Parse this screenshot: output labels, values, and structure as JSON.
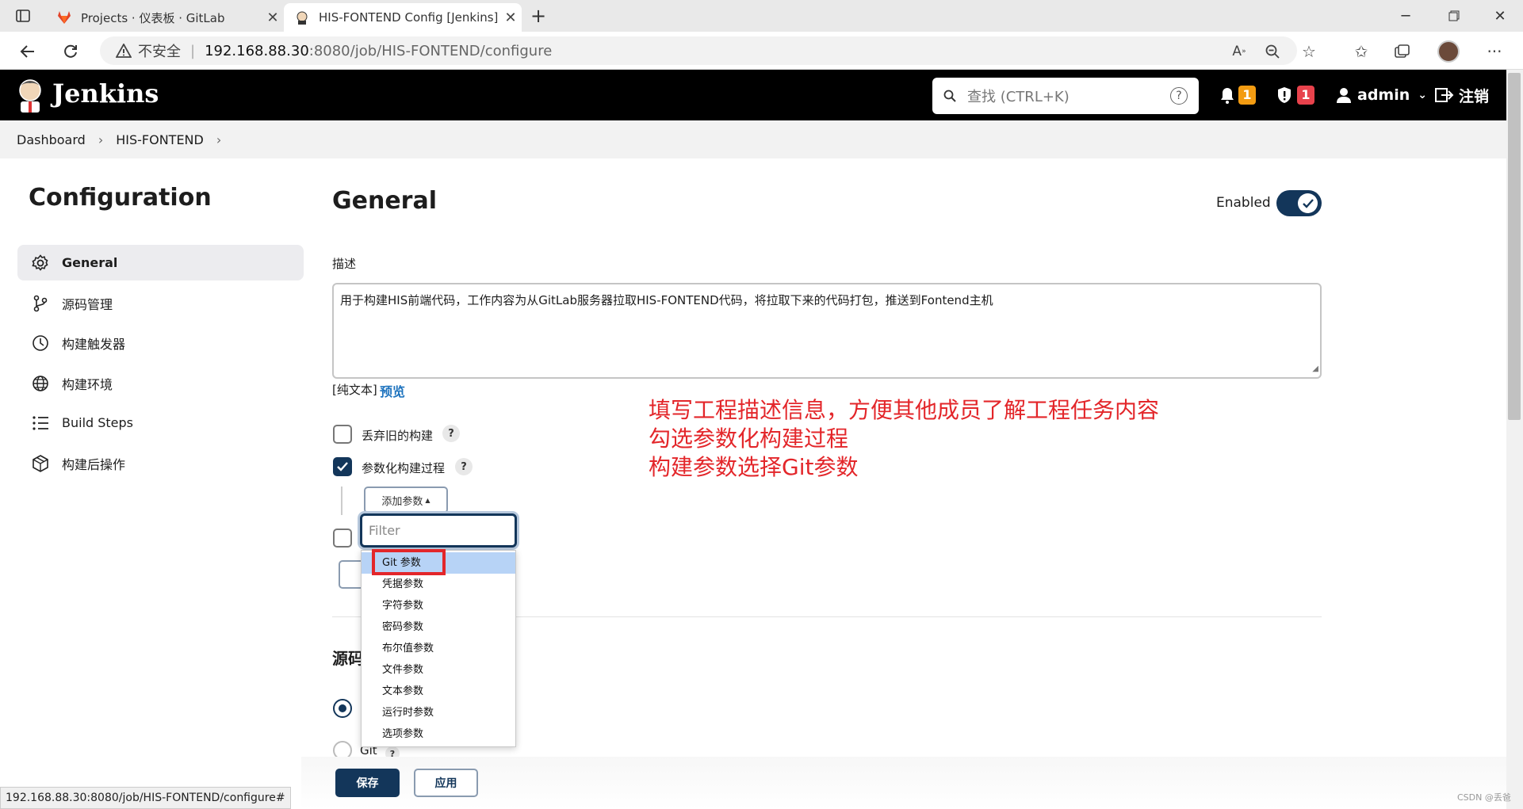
{
  "browser": {
    "tabs": [
      {
        "title": "Projects · 仪表板 · GitLab",
        "active": false
      },
      {
        "title": "HIS-FONTEND Config [Jenkins]",
        "active": true
      }
    ],
    "address": {
      "security_label": "不安全",
      "url_host": "192.168.88.30",
      "url_rest": ":8080/job/HIS-FONTEND/configure"
    },
    "status_url": "192.168.88.30:8080/job/HIS-FONTEND/configure#"
  },
  "header": {
    "brand": "Jenkins",
    "search_placeholder": "查找 (CTRL+K)",
    "notifications_count": "1",
    "security_count": "1",
    "user": "admin",
    "logout": "注销"
  },
  "breadcrumb": [
    "Dashboard",
    "HIS-FONTEND"
  ],
  "sidebar": {
    "title": "Configuration",
    "items": [
      {
        "label": "General",
        "icon": "gear-icon",
        "active": true
      },
      {
        "label": "源码管理",
        "icon": "branch-icon"
      },
      {
        "label": "构建触发器",
        "icon": "clock-icon"
      },
      {
        "label": "构建环境",
        "icon": "globe-icon"
      },
      {
        "label": "Build Steps",
        "icon": "list-icon"
      },
      {
        "label": "构建后操作",
        "icon": "package-icon"
      }
    ]
  },
  "general": {
    "heading": "General",
    "enabled_label": "Enabled",
    "description_label": "描述",
    "description_value": "用于构建HIS前端代码，工作内容为从GitLab服务器拉取HIS-FONTEND代码，将拉取下来的代码打包，推送到Fontend主机",
    "plain_text_label": "[纯文本]",
    "preview_label": "预览",
    "discard_label": "丢弃旧的构建",
    "parameterized_label": "参数化构建过程",
    "add_param_label": "添加参数",
    "filter_placeholder": "Filter",
    "param_types": [
      "Git 参数",
      "凭据参数",
      "字符参数",
      "密码参数",
      "布尔值参数",
      "文件参数",
      "文本参数",
      "运行时参数",
      "选项参数"
    ],
    "scm_heading_partial": "源码",
    "git_option": "Git"
  },
  "annotations": [
    "填写工程描述信息，方便其他成员了解工程任务内容",
    "勾选参数化构建过程",
    "构建参数选择Git参数"
  ],
  "footer": {
    "save": "保存",
    "apply": "应用"
  },
  "watermark": "CSDN @丢爸",
  "colors": {
    "primary": "#13365a",
    "annotation": "#e3262a",
    "badge_warn": "#f39c12",
    "badge_danger": "#e8424c"
  }
}
